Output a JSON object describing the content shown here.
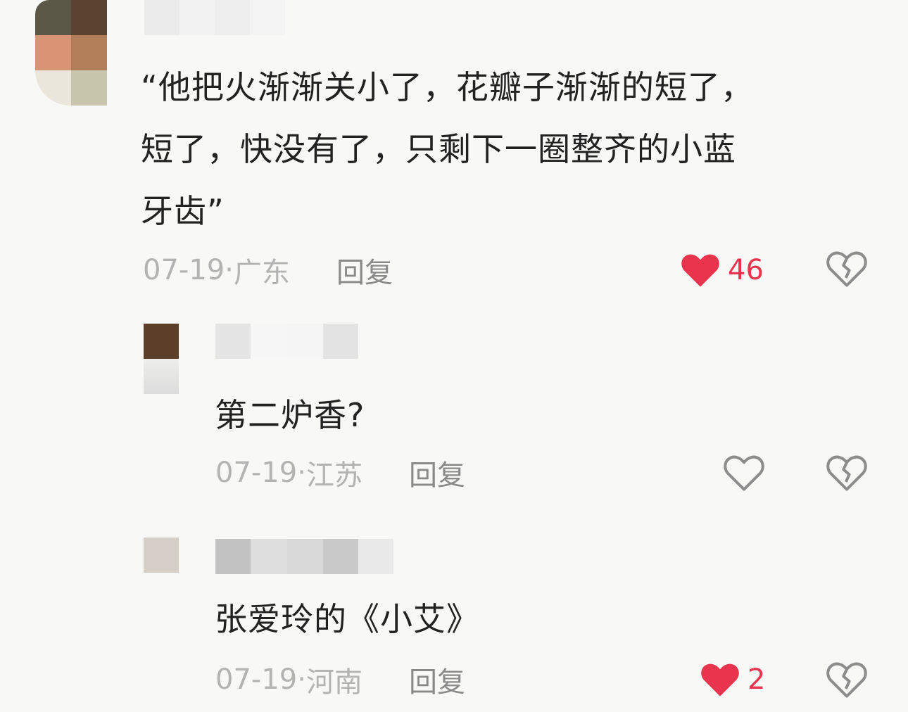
{
  "comments": [
    {
      "text": "“他把火渐渐关小了，花瓣子渐渐的短了，\n短了，快没有了，只剩下一圈整齐的小蓝\n牙齿”",
      "date": "07-19",
      "location": "广东",
      "reply_label": "回复",
      "likes": "46",
      "liked": true
    },
    {
      "text": "第二炉香?",
      "date": "07-19",
      "location": "江苏",
      "reply_label": "回复",
      "liked": false
    },
    {
      "text": "张爱玲的《小艾》",
      "date": "07-19",
      "location": "河南",
      "reply_label": "回复",
      "likes": "2",
      "liked": true
    }
  ],
  "meta_separator": " · ",
  "icons": {
    "like": "heart-icon",
    "dislike": "broken-heart-icon"
  },
  "colors": {
    "like_active": "#e8354d",
    "icon_outline": "#8c8c8c"
  }
}
